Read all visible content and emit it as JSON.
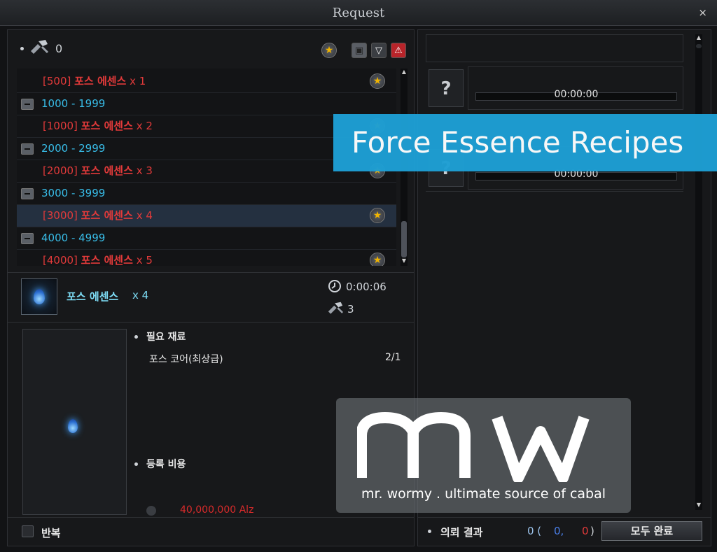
{
  "window": {
    "title": "Request",
    "close_glyph": "×"
  },
  "left": {
    "top_count": "0",
    "list": [
      {
        "type": "item",
        "prefix": "[500]",
        "name": "포스 에센스",
        "qty": "x 1"
      },
      {
        "type": "group",
        "label": "1000 - 1999"
      },
      {
        "type": "item",
        "prefix": "[1000]",
        "name": "포스 에센스",
        "qty": "x 2"
      },
      {
        "type": "group",
        "label": "2000 - 2999"
      },
      {
        "type": "item",
        "prefix": "[2000]",
        "name": "포스 에센스",
        "qty": "x 3"
      },
      {
        "type": "group",
        "label": "3000 - 3999"
      },
      {
        "type": "item",
        "prefix": "[3000]",
        "name": "포스 에센스",
        "qty": "x 4",
        "selected": true
      },
      {
        "type": "group",
        "label": "4000 - 4999"
      },
      {
        "type": "item",
        "prefix": "[4000]",
        "name": "포스 에센스",
        "qty": "x 5"
      }
    ],
    "detail": {
      "name": "포스 에센스",
      "qty": "x 4",
      "time": "0:00:06",
      "cost_count": "3"
    },
    "materials_title": "필요 재료",
    "material_name": "포스 코어(최상급)",
    "material_count": "2/1",
    "fee_title": "등록 비용",
    "fee_value": "40,000,000 Alz",
    "repeat_label": "반복"
  },
  "right": {
    "slots": [
      {
        "icon": "?",
        "time": "00:00:00"
      },
      {
        "icon": "?",
        "time": "00:00:00"
      }
    ],
    "result_label": "의뢰 결과",
    "result_total": "0 (",
    "result_blue": "0,",
    "result_red": "0",
    "result_close": ")",
    "done_button": "모두 완료"
  },
  "overlay": {
    "banner": "Force Essence Recipes",
    "watermark_logo": "mw",
    "watermark_tagline": "mr. wormy . ultimate source of cabal"
  }
}
